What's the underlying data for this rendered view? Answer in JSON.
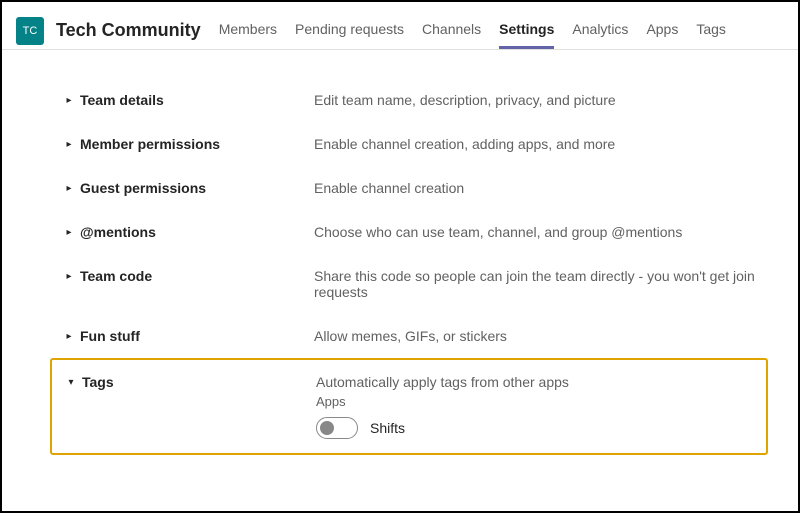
{
  "header": {
    "avatar_text": "TC",
    "team_name": "Tech Community",
    "tabs": [
      {
        "label": "Members",
        "active": false
      },
      {
        "label": "Pending requests",
        "active": false
      },
      {
        "label": "Channels",
        "active": false
      },
      {
        "label": "Settings",
        "active": true
      },
      {
        "label": "Analytics",
        "active": false
      },
      {
        "label": "Apps",
        "active": false
      },
      {
        "label": "Tags",
        "active": false
      }
    ]
  },
  "sections": [
    {
      "title": "Team details",
      "desc": "Edit team name, description, privacy, and picture",
      "expanded": false
    },
    {
      "title": "Member permissions",
      "desc": "Enable channel creation, adding apps, and more",
      "expanded": false
    },
    {
      "title": "Guest permissions",
      "desc": "Enable channel creation",
      "expanded": false
    },
    {
      "title": "@mentions",
      "desc": "Choose who can use team, channel, and group @mentions",
      "expanded": false
    },
    {
      "title": "Team code",
      "desc": "Share this code so people can join the team directly - you won't get join requests",
      "expanded": false
    },
    {
      "title": "Fun stuff",
      "desc": "Allow memes, GIFs, or stickers",
      "expanded": false
    }
  ],
  "tags_section": {
    "title": "Tags",
    "desc": "Automatically apply tags from other apps",
    "apps_label": "Apps",
    "toggle_label": "Shifts"
  }
}
